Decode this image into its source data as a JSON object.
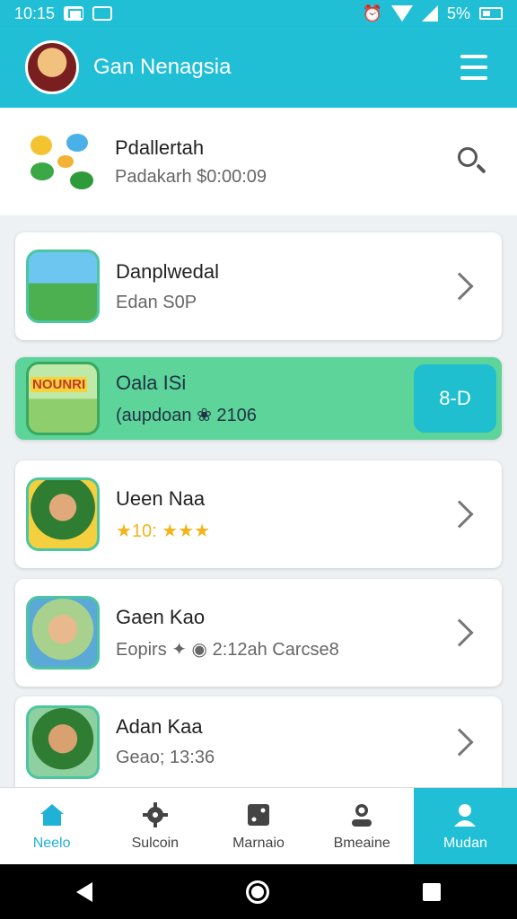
{
  "status": {
    "time": "10:15",
    "battery": "5%"
  },
  "appbar": {
    "title": "Gan Nenagsia"
  },
  "header": {
    "title": "Pdallertah",
    "subtitle": "Padakarh $0:00:09"
  },
  "items": [
    {
      "title": "Danplwedal",
      "subtitle": "Edan S0P"
    },
    {
      "title": "Oala ISi",
      "subtitle": "(aupdoan ❀ 2106",
      "button": "8-D",
      "thumb_label": "NOUNRI"
    },
    {
      "title": "Ueen Naa",
      "subtitle": "★10: ★★★"
    },
    {
      "title": "Gaen Kao",
      "subtitle": "Eopirs ✦ ◉ 2:12ah Carcse8"
    },
    {
      "title": "Adan Kaa",
      "subtitle": "Geao; 13:36"
    }
  ],
  "tabs": [
    {
      "label": "Neelo",
      "icon": "home-icon"
    },
    {
      "label": "Sulcoin",
      "icon": "gear-icon"
    },
    {
      "label": "Marnaio",
      "icon": "dice-icon"
    },
    {
      "label": "Bmeaine",
      "icon": "person-icon"
    },
    {
      "label": "Mudan",
      "icon": "user-icon"
    }
  ],
  "colors": {
    "primary": "#20bfd6",
    "green": "#5cd49a",
    "accent": "#1fbfcf"
  }
}
